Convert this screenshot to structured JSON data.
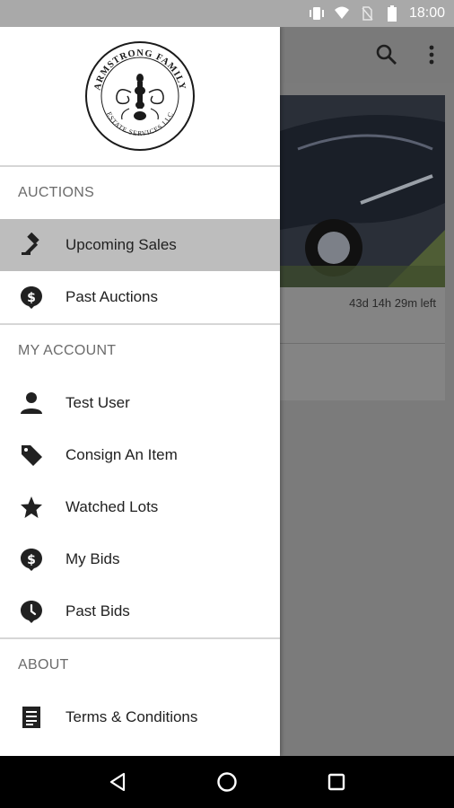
{
  "status_bar": {
    "time": "18:00",
    "icons": [
      "vibrate-icon",
      "wifi-icon",
      "no-sim-icon",
      "battery-icon"
    ]
  },
  "app": {
    "toolbar_icons": [
      "search-icon",
      "more-vert-icon"
    ],
    "card": {
      "time_left": "43d 14h 29m left"
    }
  },
  "drawer": {
    "logo": {
      "name": "ARMSTRONG FAMILY",
      "subtitle": "ESTATE SERVICES LLC"
    },
    "sections": [
      {
        "title": "AUCTIONS",
        "items": [
          {
            "label": "Upcoming Sales",
            "icon": "gavel-icon",
            "active": true
          },
          {
            "label": "Past Auctions",
            "icon": "dollar-pin-icon",
            "active": false
          }
        ]
      },
      {
        "title": "MY ACCOUNT",
        "items": [
          {
            "label": "Test User",
            "icon": "person-icon"
          },
          {
            "label": "Consign An Item",
            "icon": "tag-icon"
          },
          {
            "label": "Watched Lots",
            "icon": "star-icon"
          },
          {
            "label": "My Bids",
            "icon": "dollar-pin-icon"
          },
          {
            "label": "Past Bids",
            "icon": "clock-pin-icon"
          }
        ]
      },
      {
        "title": "ABOUT",
        "items": [
          {
            "label": "Terms & Conditions",
            "icon": "document-icon"
          }
        ]
      }
    ]
  },
  "nav_bar": {
    "buttons": [
      "back-icon",
      "home-icon",
      "recents-icon"
    ]
  }
}
